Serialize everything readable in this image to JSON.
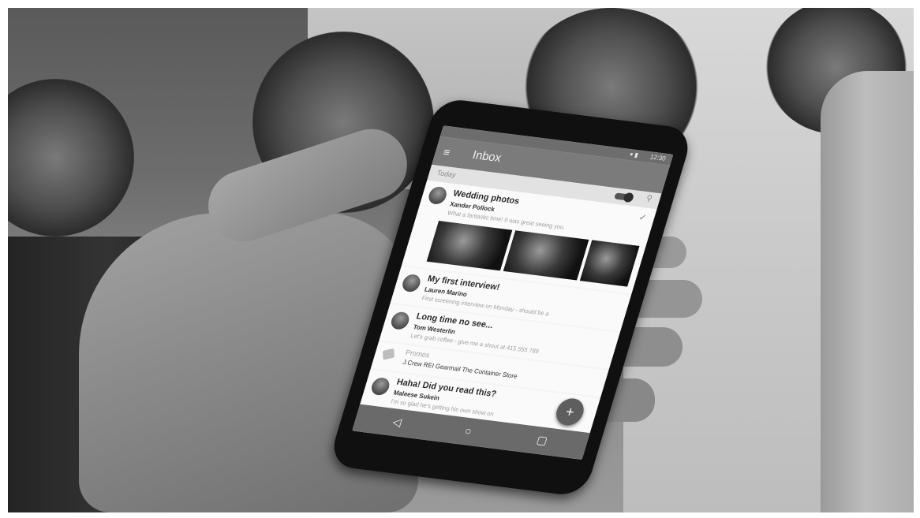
{
  "phone": {
    "status_time": "12:30",
    "app_title": "Inbox",
    "section_label": "Today",
    "emails": [
      {
        "subject": "Wedding photos",
        "sender": "Xander Pollock",
        "snippet": "What a fantastic time! It was great seeing you."
      },
      {
        "subject": "My first interview!",
        "sender": "Lauren Marino",
        "snippet": "First screening interview on Monday - should be a"
      },
      {
        "subject": "Long time no see...",
        "sender": "Tom Westerlin",
        "snippet": "Let's grab coffee - give me a shout at 415 555 789"
      },
      {
        "subject": "Haha! Did you read this?",
        "sender": "Maleese Sukein",
        "snippet": "I'm so glad he's getting his own show on"
      }
    ],
    "promo": {
      "title": "Promos",
      "snippet": "J.Crew  REI Gearmail  The Container Store"
    },
    "icons": {
      "menu": "menu-icon",
      "search": "search-icon",
      "check": "done-check-icon",
      "promo": "tag-icon",
      "compose": "plus-icon",
      "back": "nav-back-icon",
      "home": "nav-home-icon",
      "recents": "nav-recents-icon"
    },
    "nav_glyphs": {
      "back": "◁",
      "home": "○",
      "recents": "▢"
    },
    "fab_glyph": "+",
    "menu_glyph": "≡",
    "search_glyph": "⚲",
    "check_glyph": "✓"
  }
}
